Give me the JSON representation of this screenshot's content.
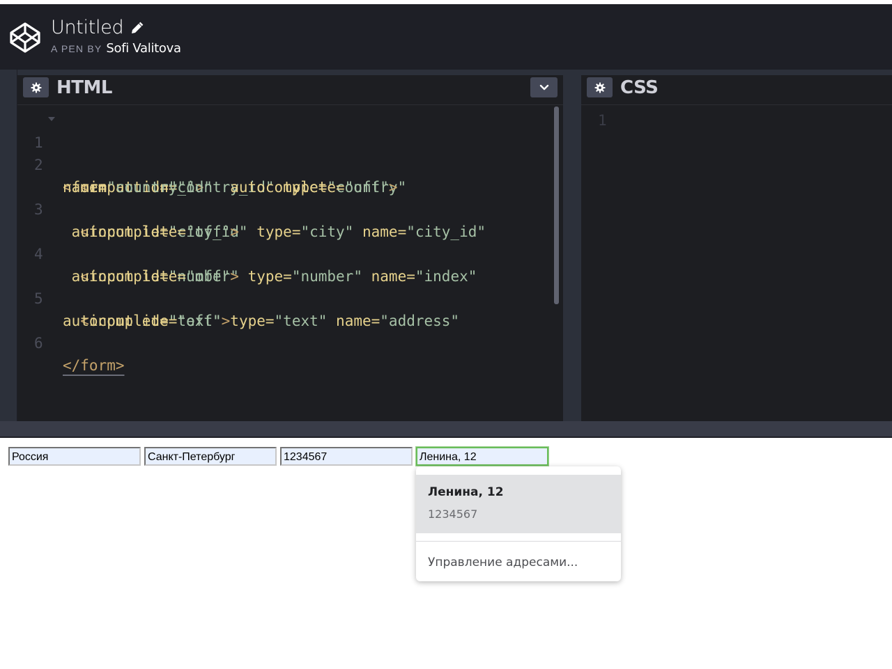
{
  "header": {
    "title": "Untitled",
    "byline_label": "A PEN BY",
    "author": "Sofi Valitova"
  },
  "html_panel": {
    "title": "HTML",
    "line_numbers": [
      "1",
      "2",
      "3",
      "4",
      "5",
      "6"
    ]
  },
  "css_panel": {
    "title": "CSS",
    "line_numbers": [
      "1"
    ]
  },
  "preview": {
    "fields": [
      {
        "value": "Россия"
      },
      {
        "value": "Санкт-Петербург"
      },
      {
        "value": "1234567"
      },
      {
        "value": "Ленина, 12"
      }
    ],
    "autofill": {
      "suggestion_main": "Ленина, 12",
      "suggestion_sub": "1234567",
      "manage_label": "Управление адресами..."
    }
  },
  "colors": {
    "header_bg": "#1e1f26",
    "editor_bg": "#1d1e22",
    "autofill_field_bg": "#e8f0fe",
    "focus_outline": "#6abd5a"
  },
  "icons": {
    "logo": "codepen-logo-icon",
    "edit": "pencil-icon",
    "settings": "gear-icon",
    "collapse": "chevron-down-icon"
  }
}
